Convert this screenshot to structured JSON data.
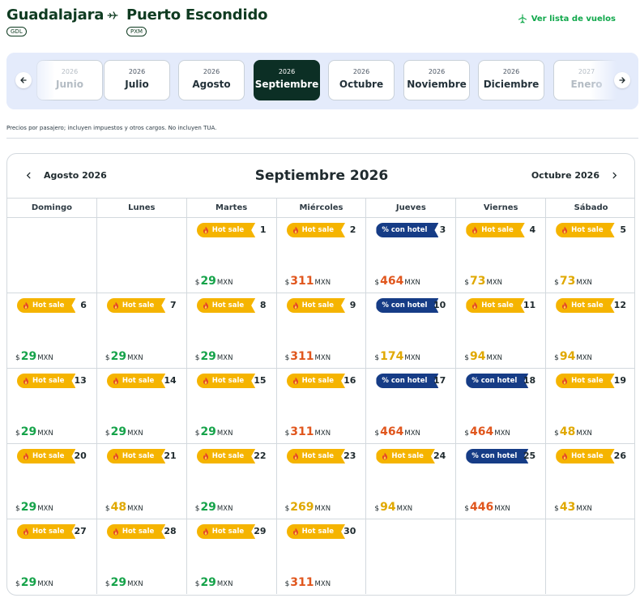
{
  "route": {
    "origin": "Guadalajara",
    "origin_code": "GDL",
    "destination": "Puerto Escondido",
    "destination_code": "PXM",
    "view_list_label": "Ver lista de vuelos"
  },
  "months": [
    {
      "year": "2026",
      "name": "Junio",
      "state": "faded"
    },
    {
      "year": "2026",
      "name": "Julio",
      "state": "normal"
    },
    {
      "year": "2026",
      "name": "Agosto",
      "state": "normal"
    },
    {
      "year": "2026",
      "name": "Septiembre",
      "state": "active"
    },
    {
      "year": "2026",
      "name": "Octubre",
      "state": "normal"
    },
    {
      "year": "2026",
      "name": "Noviembre",
      "state": "normal"
    },
    {
      "year": "2026",
      "name": "Diciembre",
      "state": "normal"
    },
    {
      "year": "2027",
      "name": "Enero",
      "state": "faded"
    }
  ],
  "price_note": "Precios por pasajero; incluyen impuestos y otros cargos. No incluyen TUA.",
  "calendar": {
    "title": "Septiembre 2026",
    "prev_month": "Agosto 2026",
    "next_month": "Octubre 2026",
    "weekdays": [
      "Domingo",
      "Lunes",
      "Martes",
      "Miércoles",
      "Jueves",
      "Viernes",
      "Sábado"
    ],
    "currency_symbol": "$",
    "currency_code": "MXN",
    "badge_labels": {
      "hot": "Hot sale",
      "hotel": "% con hotel"
    },
    "level_colors": {
      "green": "#16a34a",
      "yellow": "#e0a800",
      "orange": "#e0561d"
    },
    "days": [
      null,
      null,
      {
        "day": "1",
        "badge": "hot",
        "price": "29",
        "level": "green"
      },
      {
        "day": "2",
        "badge": "hot",
        "price": "311",
        "level": "orange"
      },
      {
        "day": "3",
        "badge": "hotel",
        "price": "464",
        "level": "orange"
      },
      {
        "day": "4",
        "badge": "hot",
        "price": "73",
        "level": "yellow"
      },
      {
        "day": "5",
        "badge": "hot",
        "price": "73",
        "level": "yellow"
      },
      {
        "day": "6",
        "badge": "hot",
        "price": "29",
        "level": "green"
      },
      {
        "day": "7",
        "badge": "hot",
        "price": "29",
        "level": "green"
      },
      {
        "day": "8",
        "badge": "hot",
        "price": "29",
        "level": "green"
      },
      {
        "day": "9",
        "badge": "hot",
        "price": "311",
        "level": "orange"
      },
      {
        "day": "10",
        "badge": "hotel",
        "price": "174",
        "level": "yellow"
      },
      {
        "day": "11",
        "badge": "hot",
        "price": "94",
        "level": "yellow"
      },
      {
        "day": "12",
        "badge": "hot",
        "price": "94",
        "level": "yellow"
      },
      {
        "day": "13",
        "badge": "hot",
        "price": "29",
        "level": "green"
      },
      {
        "day": "14",
        "badge": "hot",
        "price": "29",
        "level": "green"
      },
      {
        "day": "15",
        "badge": "hot",
        "price": "29",
        "level": "green"
      },
      {
        "day": "16",
        "badge": "hot",
        "price": "311",
        "level": "orange"
      },
      {
        "day": "17",
        "badge": "hotel",
        "price": "464",
        "level": "orange"
      },
      {
        "day": "18",
        "badge": "hotel",
        "price": "464",
        "level": "orange"
      },
      {
        "day": "19",
        "badge": "hot",
        "price": "48",
        "level": "yellow"
      },
      {
        "day": "20",
        "badge": "hot",
        "price": "29",
        "level": "green"
      },
      {
        "day": "21",
        "badge": "hot",
        "price": "48",
        "level": "yellow"
      },
      {
        "day": "22",
        "badge": "hot",
        "price": "29",
        "level": "green"
      },
      {
        "day": "23",
        "badge": "hot",
        "price": "269",
        "level": "yellow"
      },
      {
        "day": "24",
        "badge": "hot",
        "price": "94",
        "level": "yellow"
      },
      {
        "day": "25",
        "badge": "hotel",
        "price": "446",
        "level": "orange"
      },
      {
        "day": "26",
        "badge": "hot",
        "price": "43",
        "level": "yellow"
      },
      {
        "day": "27",
        "badge": "hot",
        "price": "29",
        "level": "green"
      },
      {
        "day": "28",
        "badge": "hot",
        "price": "29",
        "level": "green"
      },
      {
        "day": "29",
        "badge": "hot",
        "price": "29",
        "level": "green"
      },
      {
        "day": "30",
        "badge": "hot",
        "price": "311",
        "level": "orange"
      },
      null,
      null,
      null
    ]
  }
}
